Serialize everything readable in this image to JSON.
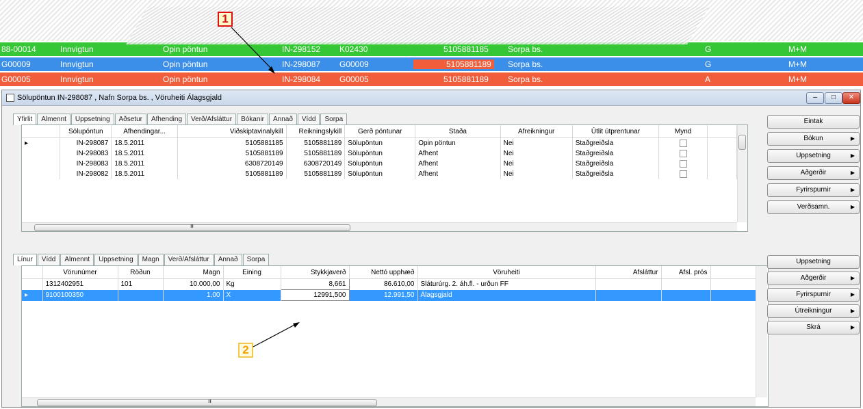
{
  "background_rows": [
    {
      "cells": [
        "88-00014",
        "Innvigtun",
        "Opin pöntun",
        "IN-298152",
        "K02430",
        "5105881185",
        "Sorpa bs.",
        "G",
        "M+M"
      ],
      "color": "#35c735"
    },
    {
      "cells": [
        "G00009",
        "Innvigtun",
        "Opin pöntun",
        "IN-298087",
        "G00009",
        "5105881189",
        "Sorpa bs.",
        "G",
        "M+M"
      ],
      "color": "#3b8fe8"
    },
    {
      "cells": [
        "G00005",
        "Innvigtun",
        "Opin pöntun",
        "IN-298084",
        "G00005",
        "5105881189",
        "Sorpa bs.",
        "A",
        "M+M"
      ],
      "color": "#f05e3c"
    }
  ],
  "callouts": {
    "one": "1",
    "two": "2"
  },
  "window": {
    "title": "Sölupöntun IN-298087 , Nafn Sorpa bs. , Vöruheiti Álagsgjald"
  },
  "header_tabs": [
    "Yfirlit",
    "Almennt",
    "Uppsetning",
    "Aðsetur",
    "Afhending",
    "Verð/Afsláttur",
    "Bókanir",
    "Annað",
    "Vídd",
    "Sorpa"
  ],
  "header_table": {
    "columns": [
      "Sölupöntun",
      "Afhendingar...",
      "Viðskiptavinalykill",
      "Reikningslykill",
      "Gerð pöntunar",
      "Staða",
      "Afreikningur",
      "Útlit útprentunar",
      "Mynd"
    ],
    "rows": [
      [
        "IN-298087",
        "18.5.2011",
        "5105881185",
        "5105881189",
        "Sölupöntun",
        "Opin pöntun",
        "Nei",
        "Staðgreiðsla"
      ],
      [
        "IN-298083",
        "18.5.2011",
        "5105881189",
        "5105881189",
        "Sölupöntun",
        "Afhent",
        "Nei",
        "Staðgreiðsla"
      ],
      [
        "IN-298083",
        "18.5.2011",
        "6308720149",
        "6308720149",
        "Sölupöntun",
        "Afhent",
        "Nei",
        "Staðgreiðsla"
      ],
      [
        "IN-298082",
        "18.5.2011",
        "5105881189",
        "5105881189",
        "Sölupöntun",
        "Afhent",
        "Nei",
        "Staðgreiðsla"
      ]
    ]
  },
  "right_buttons_top": [
    "Eintak",
    "Bókun",
    "Uppsetning",
    "Aðgerðir",
    "Fyrirspurnir",
    "Verðsamn."
  ],
  "line_tabs": [
    "Línur",
    "Vídd",
    "Almennt",
    "Uppsetning",
    "Magn",
    "Verð/Afsláttur",
    "Annað",
    "Sorpa"
  ],
  "line_table": {
    "columns": [
      "Vörunúmer",
      "Röðun",
      "Magn",
      "Eining",
      "Stykkjaverð",
      "Nettó upphæð",
      "Vöruheiti",
      "Afsláttur",
      "Afsl. prós"
    ],
    "rows": [
      [
        "1312402951",
        "101",
        "10.000,00",
        "Kg",
        "8,661",
        "86.610,00",
        "Sláturúrg. 2. áh.fl. - urðun FF",
        "",
        ""
      ],
      [
        "9100100350",
        "",
        "1,00",
        "X",
        "12991,500",
        "12.991,50",
        "Álagsgjald",
        "",
        ""
      ]
    ]
  },
  "right_buttons_bottom": [
    "Uppsetning",
    "Aðgerðir",
    "Fyrirspurnir",
    "Útreikningur",
    "Skrá"
  ],
  "window_controls": [
    "minimize",
    "maximize",
    "close"
  ]
}
